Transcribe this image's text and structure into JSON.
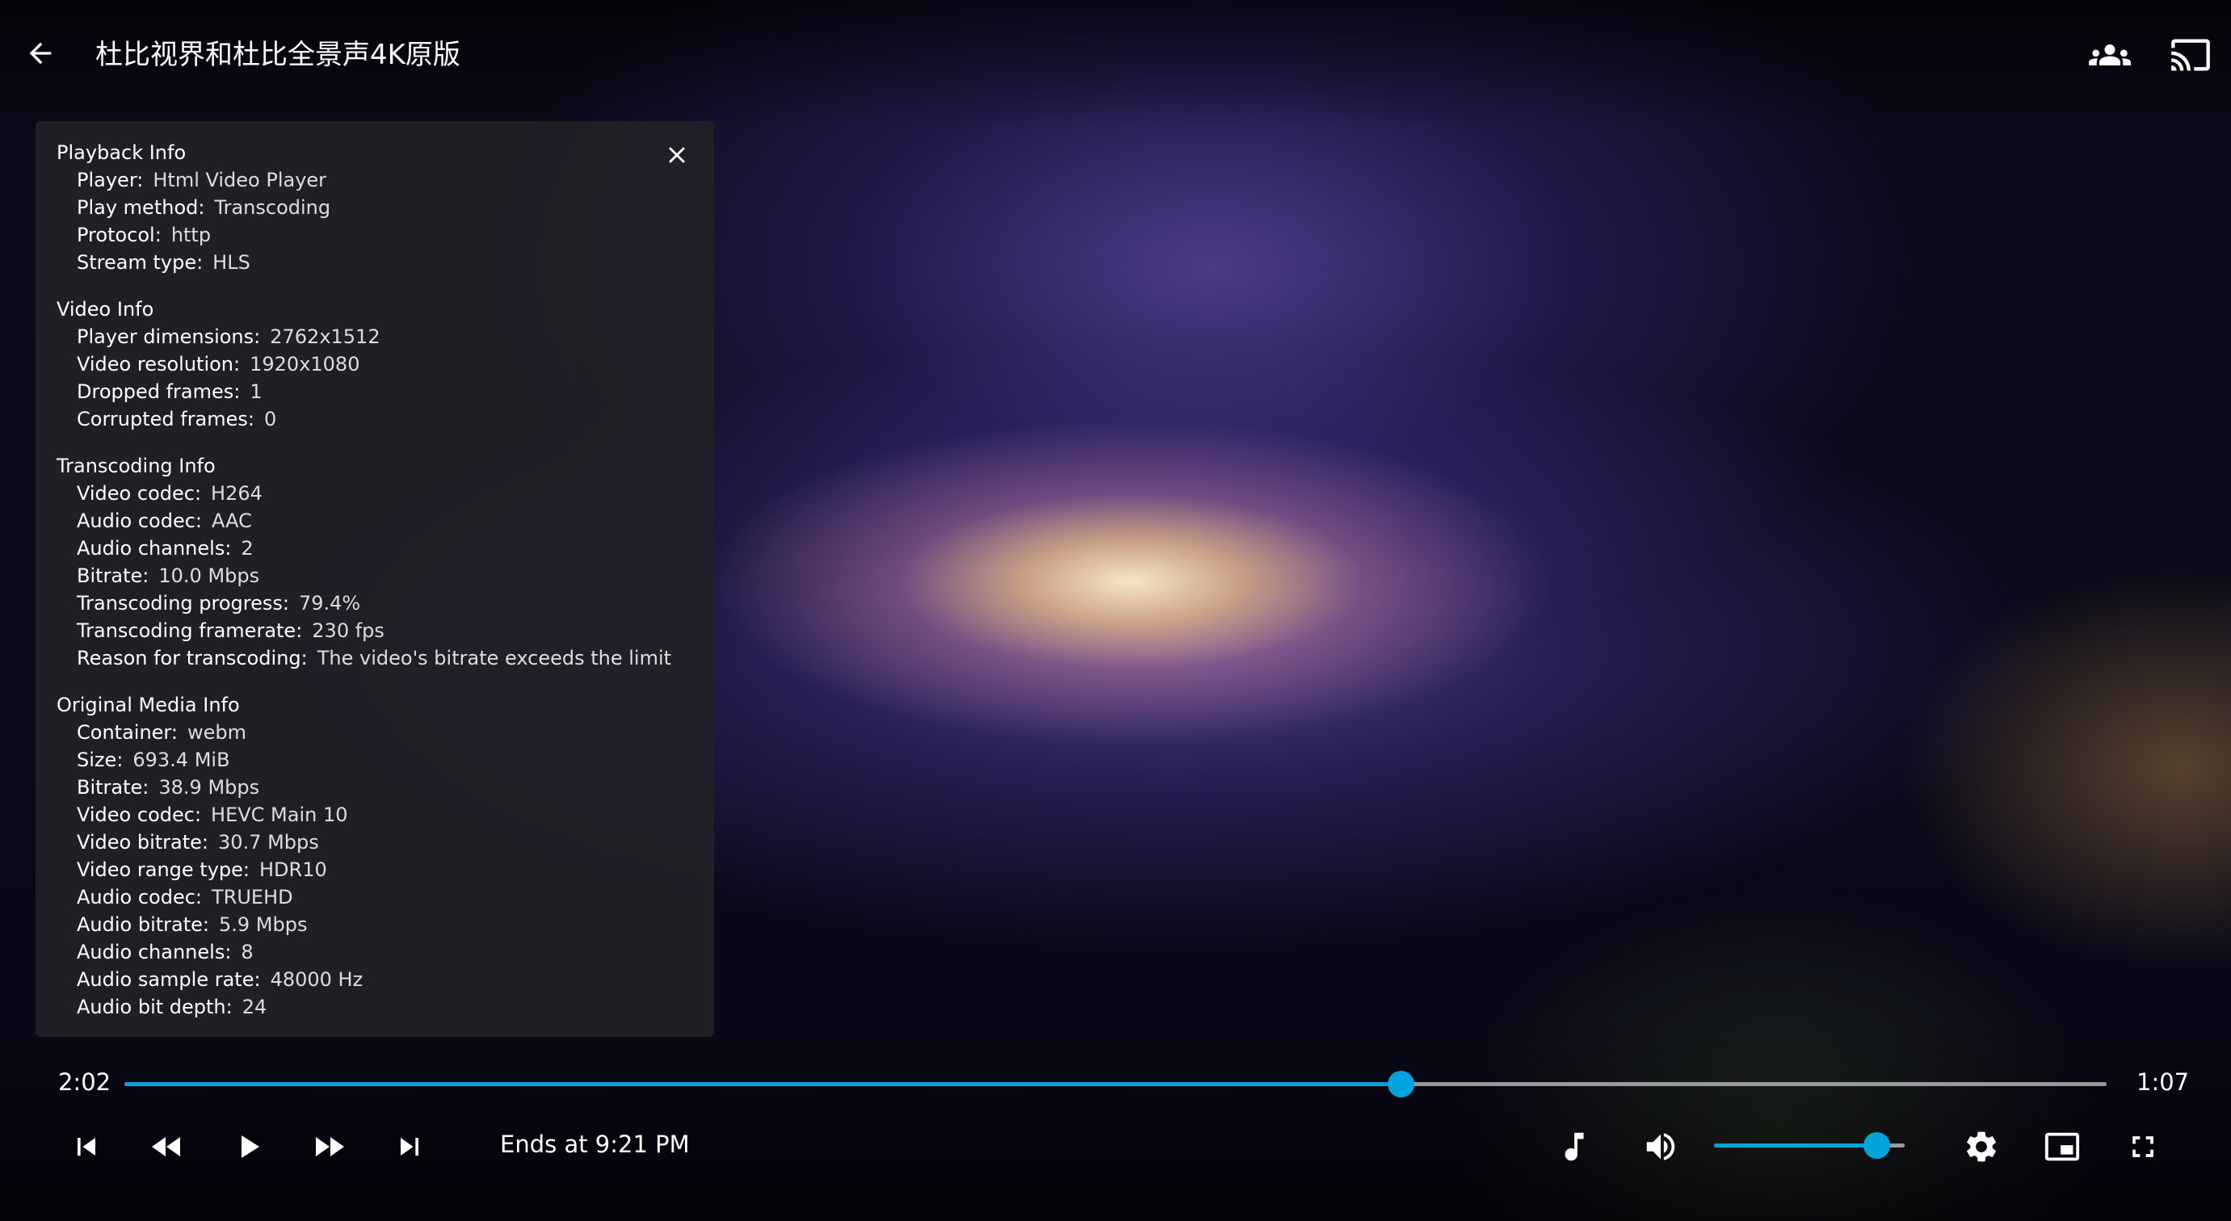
{
  "header": {
    "title": "杜比视界和杜比全景声4K原版",
    "back_icon": "arrow-left-icon",
    "syncplay_icon": "group-icon",
    "cast_icon": "cast-icon"
  },
  "playback_info": {
    "sections": [
      {
        "title": "Playback Info",
        "rows": [
          {
            "label": "Player:",
            "value": "Html Video Player"
          },
          {
            "label": "Play method:",
            "value": "Transcoding"
          },
          {
            "label": "Protocol:",
            "value": "http"
          },
          {
            "label": "Stream type:",
            "value": "HLS"
          }
        ]
      },
      {
        "title": "Video Info",
        "rows": [
          {
            "label": "Player dimensions:",
            "value": "2762x1512"
          },
          {
            "label": "Video resolution:",
            "value": "1920x1080"
          },
          {
            "label": "Dropped frames:",
            "value": "1"
          },
          {
            "label": "Corrupted frames:",
            "value": "0"
          }
        ]
      },
      {
        "title": "Transcoding Info",
        "rows": [
          {
            "label": "Video codec:",
            "value": "H264"
          },
          {
            "label": "Audio codec:",
            "value": "AAC"
          },
          {
            "label": "Audio channels:",
            "value": "2"
          },
          {
            "label": "Bitrate:",
            "value": "10.0 Mbps"
          },
          {
            "label": "Transcoding progress:",
            "value": "79.4%"
          },
          {
            "label": "Transcoding framerate:",
            "value": "230 fps"
          },
          {
            "label": "Reason for transcoding:",
            "value": "The video's bitrate exceeds the limit"
          }
        ]
      },
      {
        "title": "Original Media Info",
        "rows": [
          {
            "label": "Container:",
            "value": "webm"
          },
          {
            "label": "Size:",
            "value": "693.4 MiB"
          },
          {
            "label": "Bitrate:",
            "value": "38.9 Mbps"
          },
          {
            "label": "Video codec:",
            "value": "HEVC Main 10"
          },
          {
            "label": "Video bitrate:",
            "value": "30.7 Mbps"
          },
          {
            "label": "Video range type:",
            "value": "HDR10"
          },
          {
            "label": "Audio codec:",
            "value": "TRUEHD"
          },
          {
            "label": "Audio bitrate:",
            "value": "5.9 Mbps"
          },
          {
            "label": "Audio channels:",
            "value": "8"
          },
          {
            "label": "Audio sample rate:",
            "value": "48000 Hz"
          },
          {
            "label": "Audio bit depth:",
            "value": "24"
          }
        ]
      }
    ]
  },
  "osd": {
    "current_time": "2:02",
    "remaining_time": "1:07",
    "seek_progress": 0.644,
    "ends_at": "Ends at 9:21 PM",
    "volume_level": 0.85,
    "accent_color": "#00a4dc"
  }
}
